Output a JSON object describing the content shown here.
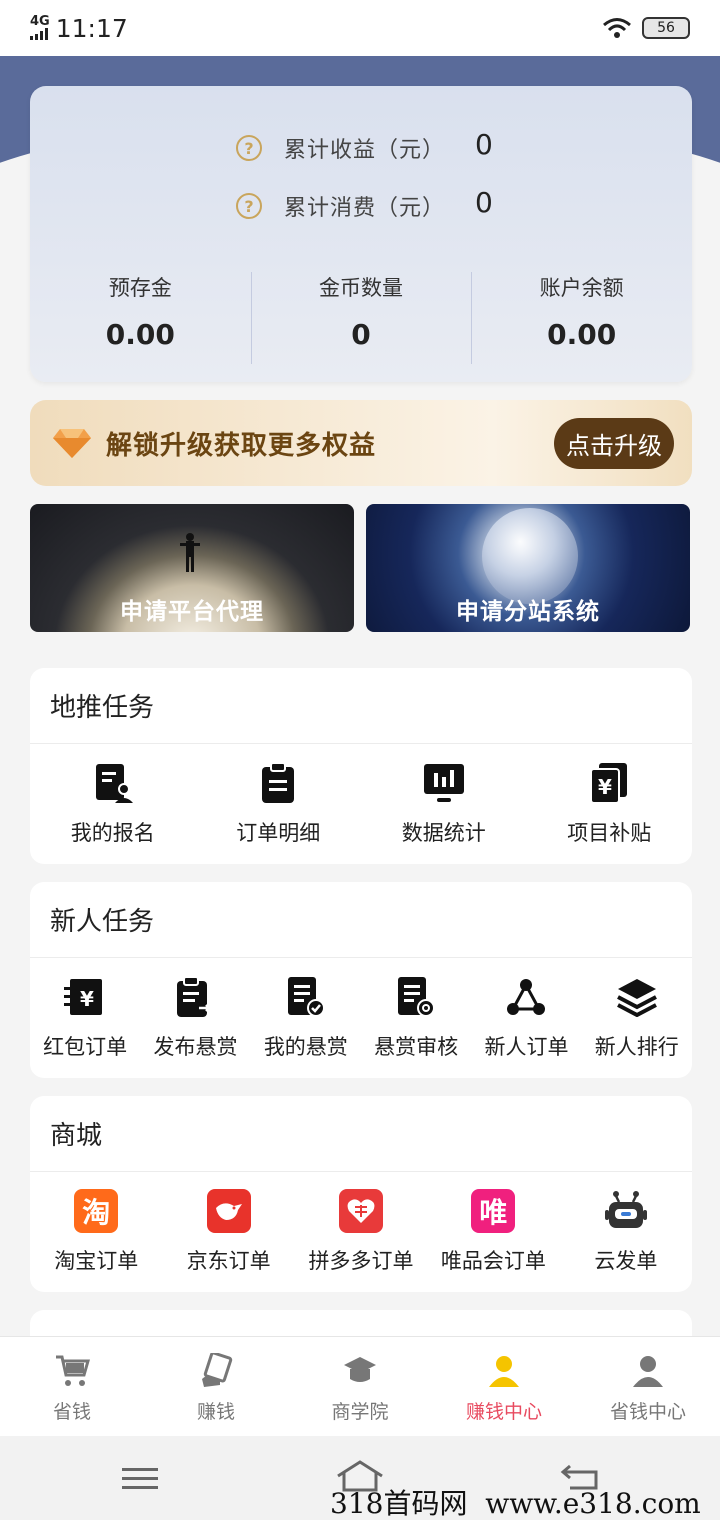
{
  "status_bar": {
    "network": "4G",
    "time": "11:17",
    "battery": "56"
  },
  "earnings": {
    "rows": [
      {
        "label": "累计收益（元）",
        "value": "0"
      },
      {
        "label": "累计消费（元）",
        "value": "0"
      }
    ],
    "balances": [
      {
        "label": "预存金",
        "value": "0.00"
      },
      {
        "label": "金币数量",
        "value": "0"
      },
      {
        "label": "账户余额",
        "value": "0.00"
      }
    ]
  },
  "upgrade": {
    "text": "解锁升级获取更多权益",
    "button": "点击升级"
  },
  "promos": [
    {
      "label": "申请平台代理"
    },
    {
      "label": "申请分站系统"
    }
  ],
  "sections": [
    {
      "title": "地推任务",
      "items": [
        {
          "label": "我的报名",
          "icon": "clipboard-person-icon"
        },
        {
          "label": "订单明细",
          "icon": "clipboard-list-icon"
        },
        {
          "label": "数据统计",
          "icon": "monitor-chart-icon"
        },
        {
          "label": "项目补贴",
          "icon": "yen-document-icon"
        }
      ]
    },
    {
      "title": "新人任务",
      "items": [
        {
          "label": "红包订单",
          "icon": "yen-receipt-icon"
        },
        {
          "label": "发布悬赏",
          "icon": "clipboard-export-icon"
        },
        {
          "label": "我的悬赏",
          "icon": "document-check-icon"
        },
        {
          "label": "悬赏审核",
          "icon": "document-gear-icon"
        },
        {
          "label": "新人订单",
          "icon": "network-nodes-icon"
        },
        {
          "label": "新人排行",
          "icon": "layers-icon"
        }
      ]
    },
    {
      "title": "商城",
      "items": [
        {
          "label": "淘宝订单",
          "icon": "taobao-icon",
          "glyph": "淘",
          "color": "#ff6a1a"
        },
        {
          "label": "京东订单",
          "icon": "jd-icon",
          "glyph": "",
          "color": "#e8332b"
        },
        {
          "label": "拼多多订单",
          "icon": "pinduoduo-icon",
          "glyph": "",
          "color": "#e83a3a"
        },
        {
          "label": "唯品会订单",
          "icon": "vipshop-icon",
          "glyph": "唯",
          "color": "#f0207e"
        },
        {
          "label": "云发单",
          "icon": "robot-icon",
          "glyph": "",
          "color": "#333333"
        }
      ]
    }
  ],
  "tabs": [
    {
      "label": "省钱",
      "icon": "cart-icon"
    },
    {
      "label": "赚钱",
      "icon": "hand-card-icon"
    },
    {
      "label": "商学院",
      "icon": "graduation-cap-icon"
    },
    {
      "label": "赚钱中心",
      "icon": "user-yellow-icon",
      "active": true
    },
    {
      "label": "省钱中心",
      "icon": "user-gray-icon"
    }
  ],
  "colors": {
    "accent": "#e84a5f",
    "header": "#5a6b9a",
    "gold": "#c9a55c",
    "upgrade_button": "#5b3a16"
  },
  "watermark": "318首码网  www.e318.com"
}
